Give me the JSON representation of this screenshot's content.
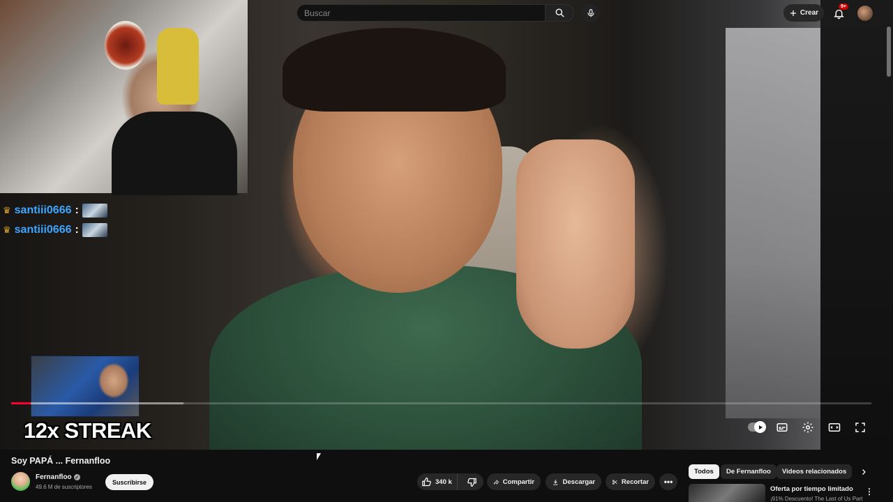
{
  "search": {
    "placeholder": "Buscar"
  },
  "header": {
    "create_label": "Crear",
    "notification_count": "9+"
  },
  "overlay": {
    "chat": [
      {
        "user": "santiii0666",
        "separator": ":"
      },
      {
        "user": "santiii0666",
        "separator": ":"
      }
    ],
    "streak_text": "12x STREAK"
  },
  "player": {
    "progress_percent": 2.3,
    "buffered_percent": 20
  },
  "video": {
    "title": "Soy PAPÁ ... Fernanfloo",
    "channel": "Fernanfloo",
    "subscribers": "49.6 M de suscriptores",
    "subscribe_label": "Suscribirse"
  },
  "actions": {
    "like_count": "340 k",
    "share_label": "Compartir",
    "download_label": "Descargar",
    "clip_label": "Recortar",
    "more_label": "•••"
  },
  "chips": [
    "Todos",
    "De Fernanfloo",
    "Videos relacionados"
  ],
  "recommendation": {
    "title": "Oferta por tiempo limitado",
    "subtitle": "¡91% Descuento! The Last of Us Part"
  },
  "colors": {
    "accent": "#ff0033",
    "link": "#3ea6ff",
    "background": "#0f0f0f"
  }
}
